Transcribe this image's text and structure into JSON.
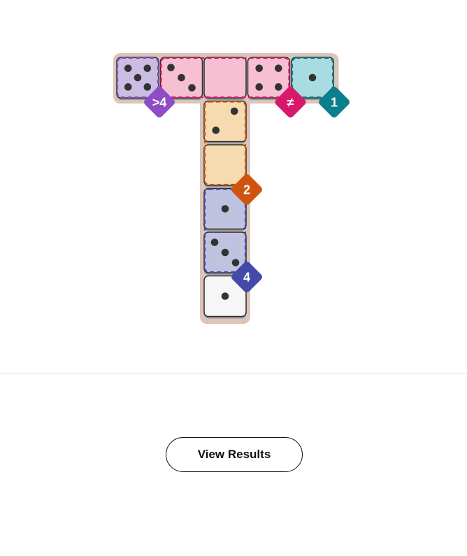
{
  "puzzle": {
    "board_cells": [
      {
        "id": "r0c0",
        "col": 0,
        "row": 0,
        "pips": 5,
        "region": "purple-gt4"
      },
      {
        "id": "r0c1",
        "col": 1,
        "row": 0,
        "pips": 3,
        "region": "pink-neq"
      },
      {
        "id": "r0c2",
        "col": 2,
        "row": 0,
        "pips": 0,
        "region": "pink-neq"
      },
      {
        "id": "r0c3",
        "col": 3,
        "row": 0,
        "pips": 4,
        "region": "pink-neq"
      },
      {
        "id": "r0c4",
        "col": 4,
        "row": 0,
        "pips": 1,
        "region": "teal-sum1"
      },
      {
        "id": "r1c2",
        "col": 2,
        "row": 1,
        "pips": 2,
        "region": "orange-sum2"
      },
      {
        "id": "r2c2",
        "col": 2,
        "row": 2,
        "pips": 0,
        "region": "orange-sum2"
      },
      {
        "id": "r3c2",
        "col": 2,
        "row": 3,
        "pips": 1,
        "region": "navy-sum4"
      },
      {
        "id": "r4c2",
        "col": 2,
        "row": 4,
        "pips": 3,
        "region": "navy-sum4"
      },
      {
        "id": "r5c2",
        "col": 2,
        "row": 5,
        "pips": 1,
        "region": null
      }
    ],
    "regions": [
      {
        "id": "purple-gt4",
        "color": "#8e4cc6",
        "fill": "#cbbde2",
        "cells": [
          "r0c0"
        ],
        "label": ">4"
      },
      {
        "id": "pink-neq",
        "color": "#d8186b",
        "fill": "#f6bfd2",
        "cells": [
          "r0c1",
          "r0c2",
          "r0c3"
        ],
        "label": "≠"
      },
      {
        "id": "teal-sum1",
        "color": "#0a7f8e",
        "fill": "#a9dce2",
        "cells": [
          "r0c4"
        ],
        "label": "1"
      },
      {
        "id": "orange-sum2",
        "color": "#d0540f",
        "fill": "#f7dbb0",
        "cells": [
          "r1c2",
          "r2c2"
        ],
        "label": "2"
      },
      {
        "id": "navy-sum4",
        "color": "#434aa8",
        "fill": "#bfc3e0",
        "cells": [
          "r3c2",
          "r4c2"
        ],
        "label": "4"
      }
    ],
    "colors": {
      "tray": "#dbc5b9",
      "tile_outline": "#2a2a2a",
      "plain_tile_fill": "#f6f6f6",
      "pip": "#333333"
    }
  },
  "footer": {
    "view_results_label": "View Results"
  }
}
